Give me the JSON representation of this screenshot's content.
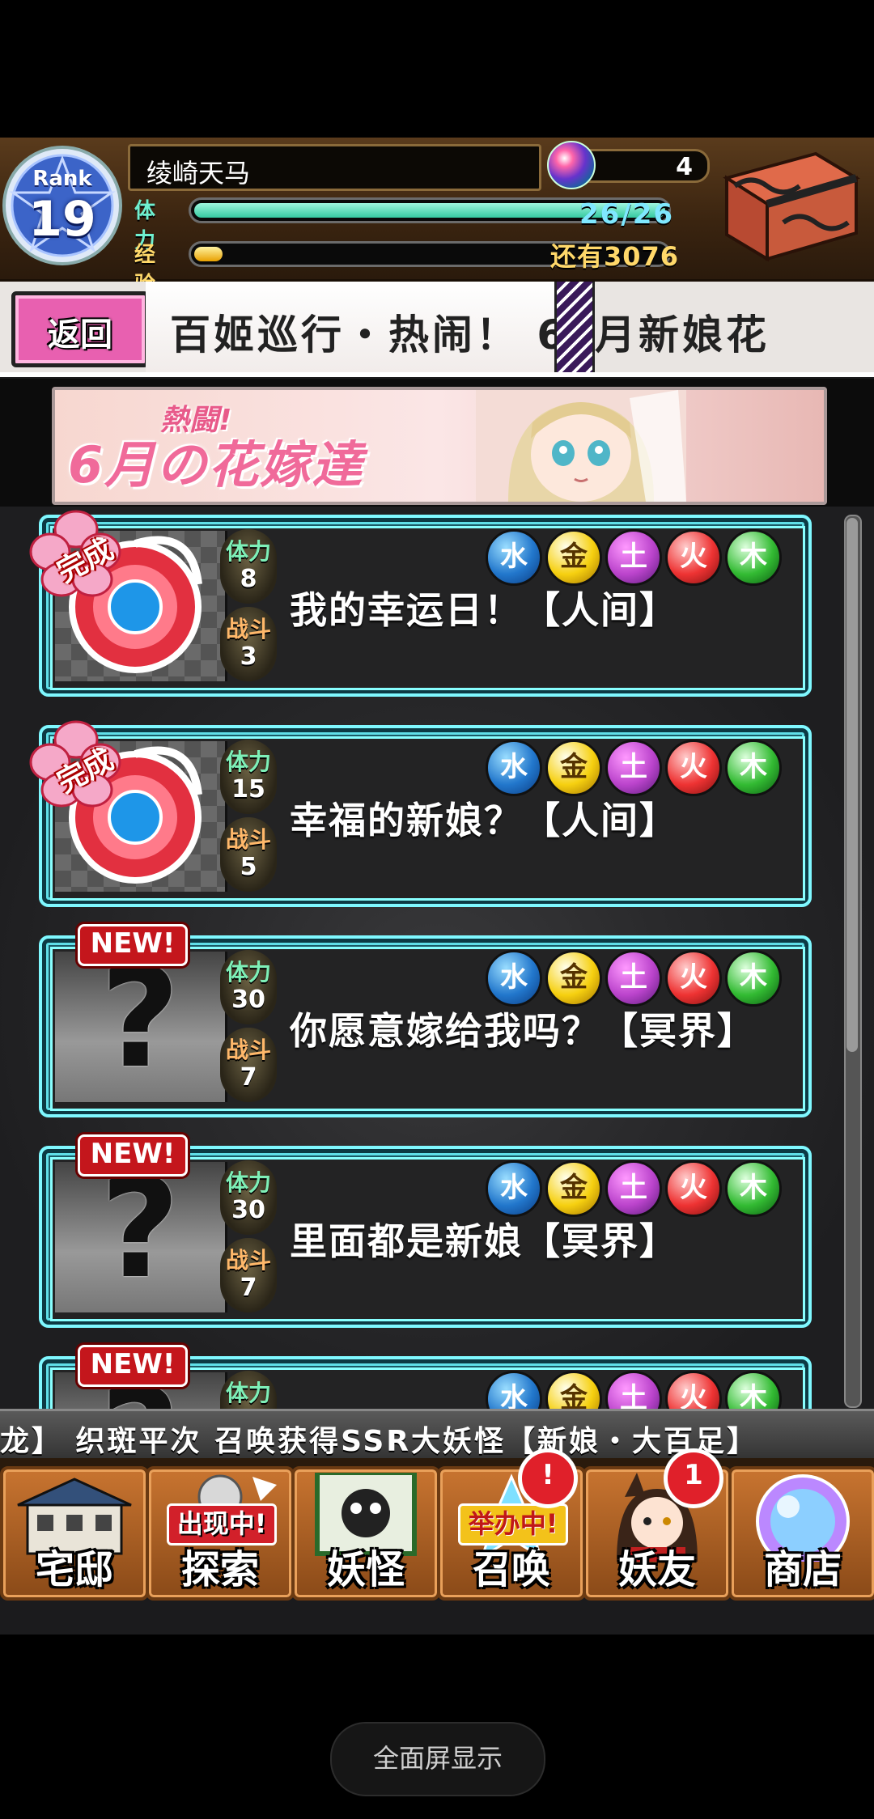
{
  "player": {
    "rank_label": "Rank",
    "rank_level": "19",
    "name": "绫崎天马",
    "stamina_label": "体力",
    "stamina_value": "26/26",
    "stamina_fraction": 1.0,
    "exp_label": "经验",
    "exp_remaining": "还有3076",
    "exp_fraction": 0.06,
    "gem_count": "4"
  },
  "header": {
    "back_label": "返回",
    "event_title": "百姬巡行・热闹！ 6月新娘花",
    "event_title_visible": "百姬巡行・热闹！ 6",
    "event_title_overflow": "月新娘花"
  },
  "banner": {
    "script_top": "熱闘!",
    "script_main": "6月の花嫁達"
  },
  "cost_labels": {
    "stamina": "体力",
    "battle": "战斗"
  },
  "elements": [
    {
      "icon": "water-orb-icon",
      "glyph": "水"
    },
    {
      "icon": "gold-orb-icon",
      "glyph": "金"
    },
    {
      "icon": "earth-orb-icon",
      "glyph": "土"
    },
    {
      "icon": "fire-orb-icon",
      "glyph": "火"
    },
    {
      "icon": "wood-orb-icon",
      "glyph": "木"
    }
  ],
  "quests": [
    {
      "title": "我的幸运日！【人间】",
      "stamina": "8",
      "battles": "3",
      "status": "完成"
    },
    {
      "title": "幸福的新娘？【人间】",
      "stamina": "15",
      "battles": "5",
      "status": "完成"
    },
    {
      "title": "你愿意嫁给我吗？【冥界】",
      "stamina": "30",
      "battles": "7",
      "status": "NEW!"
    },
    {
      "title": "里面都是新娘【冥界】",
      "stamina": "30",
      "battles": "7",
      "status": "NEW!"
    },
    {
      "title": "",
      "stamina": "",
      "battles": "",
      "status": "NEW!"
    }
  ],
  "ticker": {
    "text": "龙】    织斑平次 召唤获得SSR大妖怪【新娘・大百足】"
  },
  "nav": {
    "home": "宅邸",
    "explore": "探索",
    "explore_tag": "出现中!",
    "yokai": "妖怪",
    "summon": "召唤",
    "summon_tag": "举办中!",
    "summon_badge": "!",
    "friends": "妖友",
    "friends_badge": "1",
    "shop": "商店"
  },
  "system": {
    "fullscreen_label": "全面屏显示"
  },
  "colors": {
    "accent_cyan": "#7ff8ff",
    "stamina_bar": "#5fe6c0",
    "exp_bar": "#ffd23a",
    "nav_wood": "#c87430"
  }
}
